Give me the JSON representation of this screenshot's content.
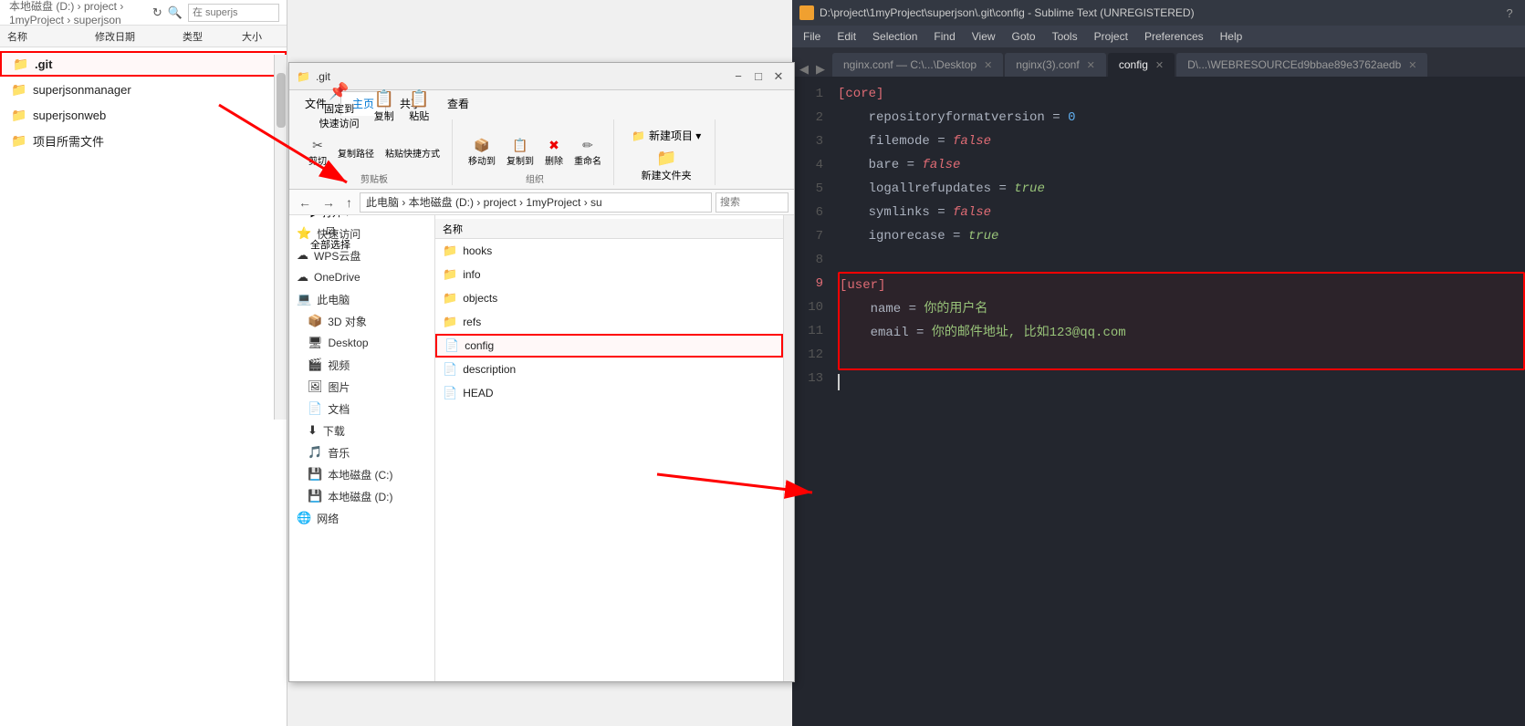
{
  "os": {
    "breadcrumb": "本地磁盘 (D:)  ›  project  ›  1myProject  ›  superjson",
    "search_placeholder": "在 superjs",
    "column_name": "名称",
    "column_date": "修改日期",
    "column_type": "类型",
    "column_size": "大小"
  },
  "left_panel": {
    "files": [
      {
        "name": ".git",
        "type": "folder",
        "highlighted": true
      },
      {
        "name": "superjsonmanager",
        "type": "folder"
      },
      {
        "name": "superjsonweb",
        "type": "folder"
      },
      {
        "name": "项目所需文件",
        "type": "folder"
      }
    ]
  },
  "explorer_window": {
    "title": ".git",
    "tabs": [
      "文件",
      "主页",
      "共享",
      "查看"
    ],
    "active_tab": "主页",
    "ribbon_groups": [
      {
        "label": "剪贴板",
        "buttons": [
          "固定到快速访问",
          "复制",
          "粘贴",
          "✂ 剪切",
          "复制路径",
          "粘贴快捷方式"
        ]
      },
      {
        "label": "组织",
        "buttons": [
          "移动到",
          "复制到",
          "删除",
          "重命名"
        ]
      }
    ],
    "new_btn": "新建文件夹",
    "open_btn": "打开",
    "select_all": "全部选择",
    "new_project": "新建项目",
    "nav_breadcrumb": "此电脑 › 本地磁盘 (D:) › project › 1myProject › su",
    "sidebar_items": [
      {
        "label": "快速访问",
        "icon": "⭐"
      },
      {
        "label": "WPS云盘",
        "icon": "☁"
      },
      {
        "label": "OneDrive",
        "icon": "☁"
      },
      {
        "label": "此电脑",
        "icon": "💻"
      },
      {
        "label": "3D 对象",
        "icon": "📦"
      },
      {
        "label": "Desktop",
        "icon": "🖥"
      },
      {
        "label": "视频",
        "icon": "🎬"
      },
      {
        "label": "图片",
        "icon": "🖼"
      },
      {
        "label": "文档",
        "icon": "📄"
      },
      {
        "label": "下载",
        "icon": "⬇"
      },
      {
        "label": "音乐",
        "icon": "🎵"
      },
      {
        "label": "本地磁盘 (C:)",
        "icon": "💾"
      },
      {
        "label": "本地磁盘 (D:)",
        "icon": "💾"
      },
      {
        "label": "网络",
        "icon": "🌐"
      }
    ],
    "files": [
      {
        "name": "hooks",
        "type": "folder"
      },
      {
        "name": "info",
        "type": "folder"
      },
      {
        "name": "objects",
        "type": "folder"
      },
      {
        "name": "refs",
        "type": "folder"
      },
      {
        "name": "config",
        "type": "file",
        "highlighted": true
      },
      {
        "name": "description",
        "type": "file"
      },
      {
        "name": "HEAD",
        "type": "file"
      }
    ]
  },
  "sublime": {
    "title": "D:\\project\\1myProject\\superjson\\.git\\config - Sublime Text (UNREGISTERED)",
    "icon_color": "#f0a030",
    "menubar": [
      "File",
      "Edit",
      "Selection",
      "Find",
      "View",
      "Goto",
      "Tools",
      "Project",
      "Preferences",
      "Help"
    ],
    "tabs": [
      {
        "label": "nginx.conf — C:\\...\\Desktop",
        "active": false
      },
      {
        "label": "nginx(3).conf",
        "active": false
      },
      {
        "label": "config",
        "active": true
      },
      {
        "label": "D\\...\\WEBRESOURCEd9bbae89e3762aedb",
        "active": false
      }
    ],
    "code_lines": [
      {
        "num": 1,
        "text": "[core]",
        "type": "section"
      },
      {
        "num": 2,
        "text": "    repositoryformatversion = 0",
        "type": "key-val-num"
      },
      {
        "num": 3,
        "text": "    filemode = false",
        "type": "key-val-false"
      },
      {
        "num": 4,
        "text": "    bare = false",
        "type": "key-val-false"
      },
      {
        "num": 5,
        "text": "    logallrefupdates = true",
        "type": "key-val-true"
      },
      {
        "num": 6,
        "text": "    symlinks = false",
        "type": "key-val-false"
      },
      {
        "num": 7,
        "text": "    ignorecase = true",
        "type": "key-val-true"
      },
      {
        "num": 8,
        "text": "",
        "type": "empty"
      },
      {
        "num": 9,
        "text": "[user]",
        "type": "section",
        "highlight_start": true
      },
      {
        "num": 10,
        "text": "    name = 你的用户名",
        "type": "key-val-comment"
      },
      {
        "num": 11,
        "text": "    email = 你的邮件地址, 比如123@qq.com",
        "type": "key-val-comment"
      },
      {
        "num": 12,
        "text": "",
        "type": "empty",
        "highlight_end": true
      },
      {
        "num": 13,
        "text": "",
        "type": "cursor"
      }
    ]
  }
}
